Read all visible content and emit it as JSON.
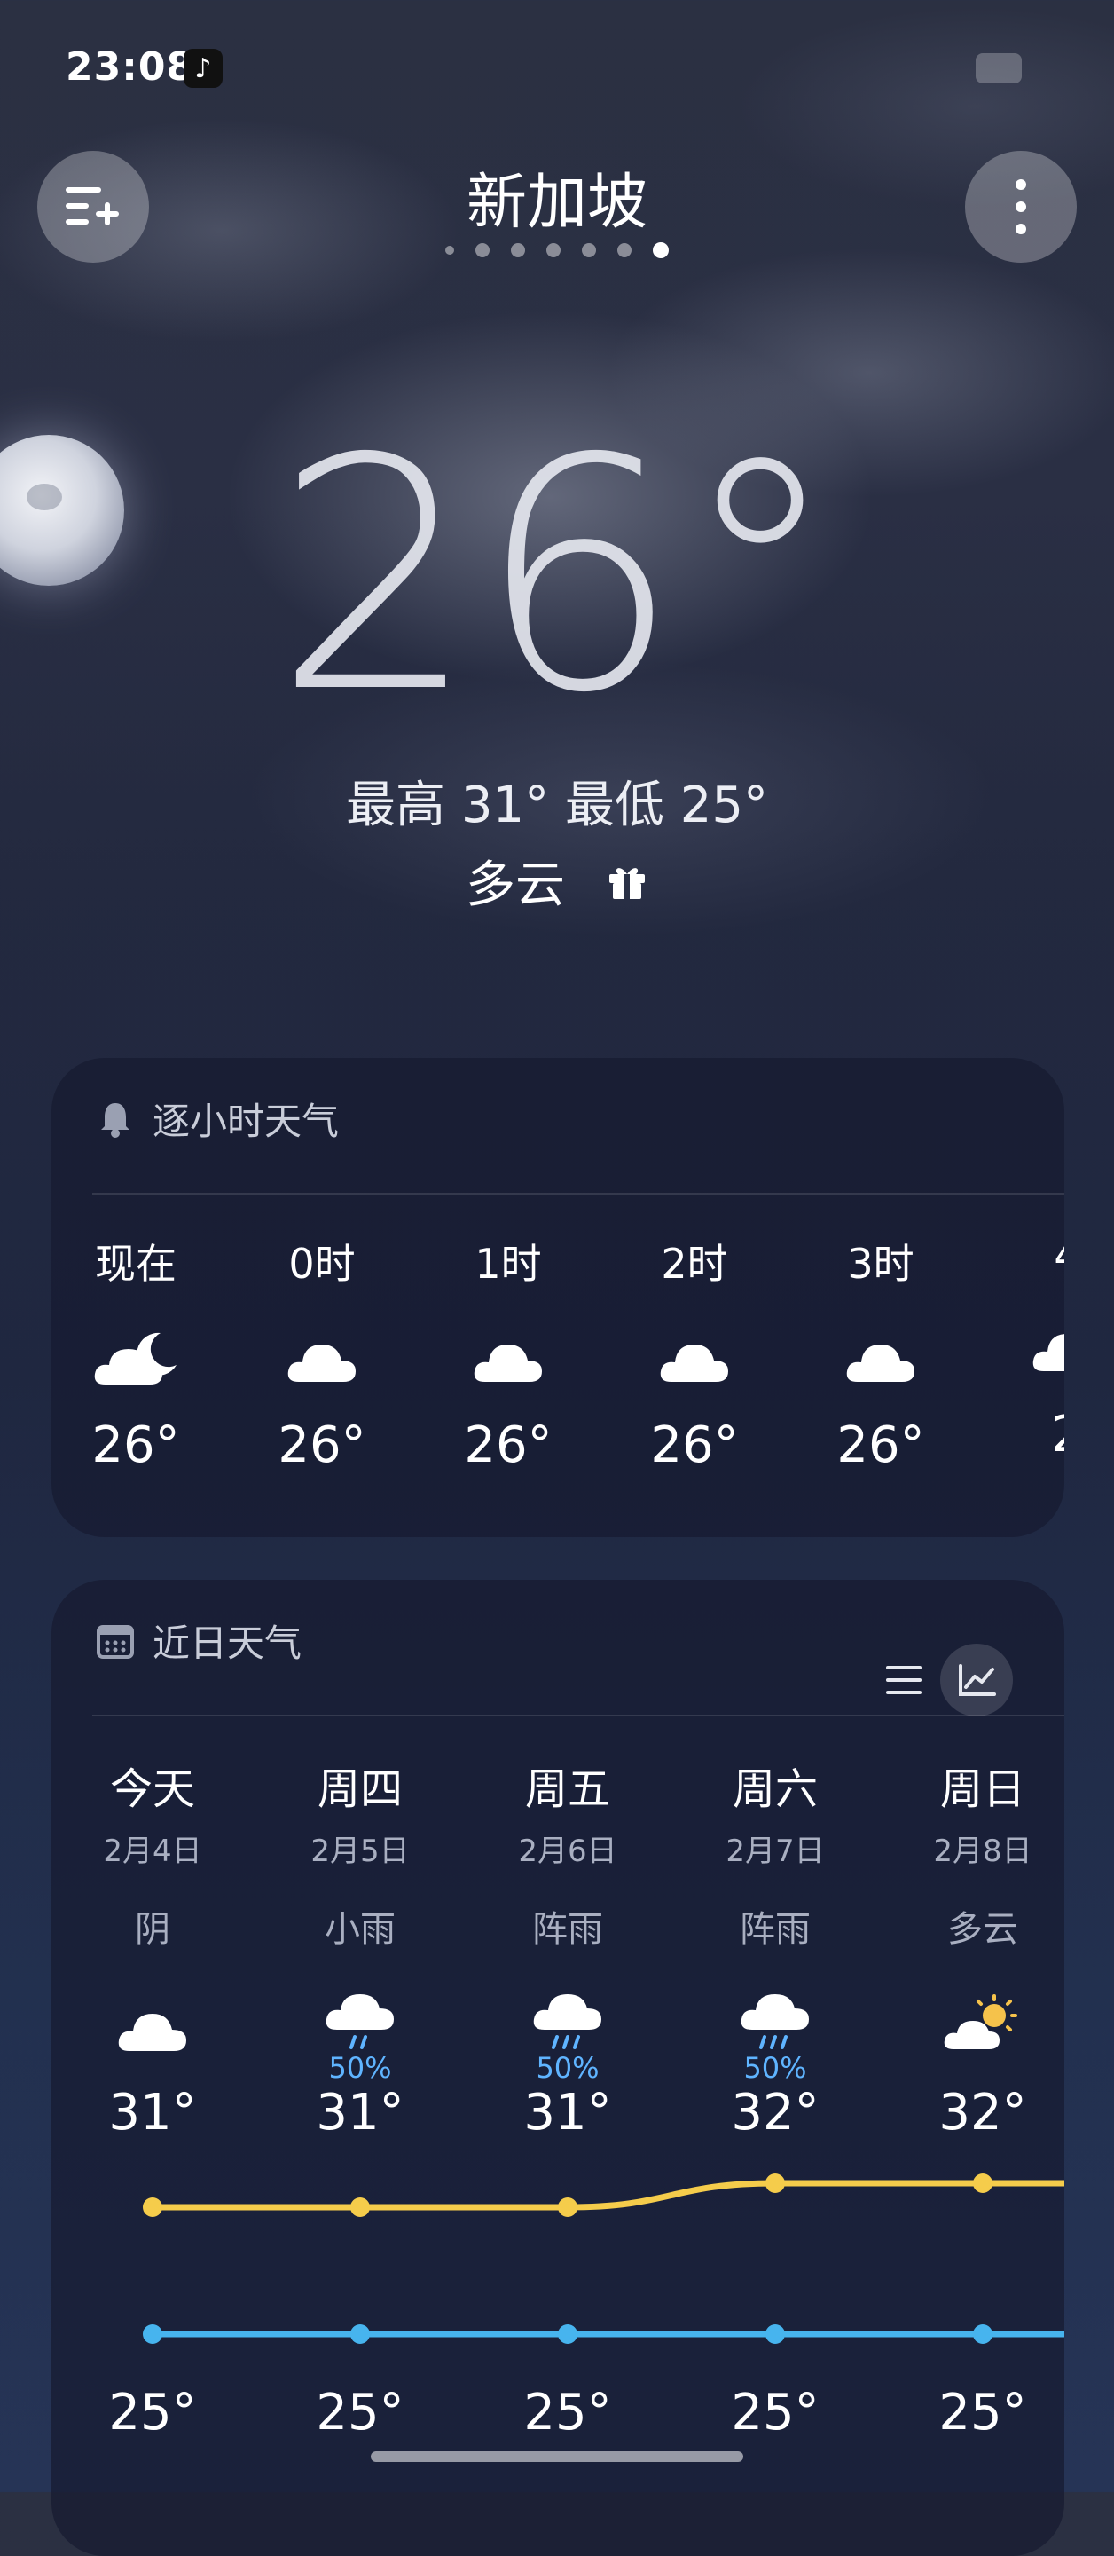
{
  "status_bar": {
    "time": "23:08",
    "app_badge_icon": "tiktok-icon"
  },
  "header": {
    "city": "新加坡",
    "page_count": 7,
    "active_page": 7,
    "menu_icon": "add-city-list-icon",
    "more_icon": "more-vertical-icon"
  },
  "current": {
    "temperature": "26°",
    "high_low": "最高 31° 最低 25°",
    "condition": "多云",
    "gift_icon": "gift-icon"
  },
  "hourly": {
    "title": "逐小时天气",
    "title_icon": "bell-icon",
    "items": [
      {
        "time": "现在",
        "icon": "partly-cloudy-night-icon",
        "temp": "26°"
      },
      {
        "time": "0时",
        "icon": "cloud-icon",
        "temp": "26°"
      },
      {
        "time": "1时",
        "icon": "cloud-icon",
        "temp": "26°"
      },
      {
        "time": "2时",
        "icon": "cloud-icon",
        "temp": "26°"
      },
      {
        "time": "3时",
        "icon": "cloud-icon",
        "temp": "26°"
      },
      {
        "time": "4",
        "icon": "cloud-icon",
        "temp": "2"
      }
    ]
  },
  "daily": {
    "title": "近日天气",
    "title_icon": "calendar-icon",
    "list_view_icon": "list-view-icon",
    "chart_view_icon": "line-chart-icon",
    "high_color": "#f5cc4b",
    "low_color": "#47b4ee",
    "days": [
      {
        "name": "今天",
        "date": "2月4日",
        "condition": "阴",
        "icon": "cloud-icon",
        "precip": "",
        "high": "31°",
        "low": "25°"
      },
      {
        "name": "周四",
        "date": "2月5日",
        "condition": "小雨",
        "icon": "light-rain-icon",
        "precip": "50%",
        "high": "31°",
        "low": "25°"
      },
      {
        "name": "周五",
        "date": "2月6日",
        "condition": "阵雨",
        "icon": "shower-icon",
        "precip": "50%",
        "high": "31°",
        "low": "25°"
      },
      {
        "name": "周六",
        "date": "2月7日",
        "condition": "阵雨",
        "icon": "shower-icon",
        "precip": "50%",
        "high": "32°",
        "low": "25°"
      },
      {
        "name": "周日",
        "date": "2月8日",
        "condition": "多云",
        "icon": "partly-cloudy-day-icon",
        "precip": "",
        "high": "32°",
        "low": "25°"
      }
    ],
    "high_values": [
      31,
      31,
      31,
      32,
      32
    ],
    "low_values": [
      25,
      25,
      25,
      25,
      25
    ]
  }
}
